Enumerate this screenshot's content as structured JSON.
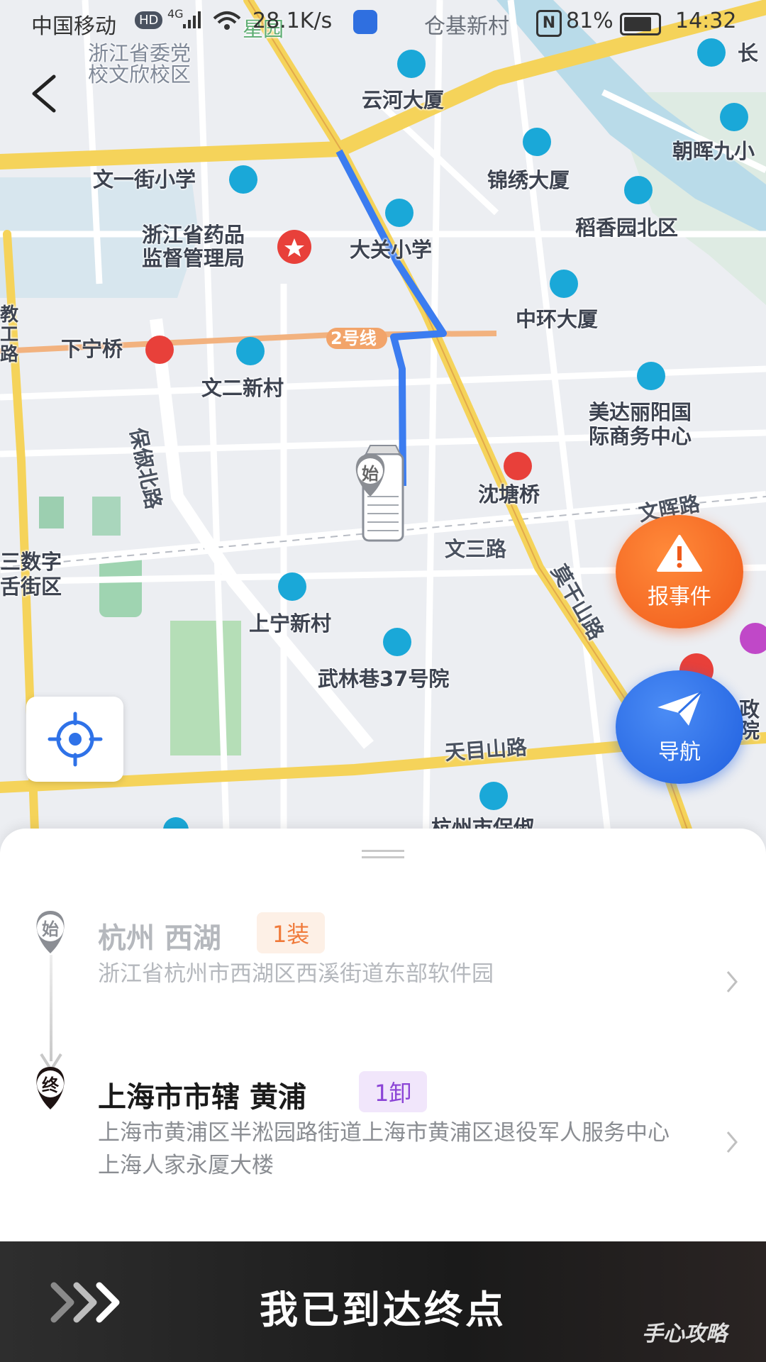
{
  "status_bar": {
    "carrier": "中国移动",
    "hd": "HD",
    "network": "4G",
    "speed": "28.1K/s",
    "location_text": "仓基新村",
    "nfc": "N",
    "battery": "81%",
    "time": "14:32"
  },
  "map": {
    "labels": {
      "zhejiang_party_school": "浙江省委党\n校文欣校区",
      "yunhe_building": "云河大厦",
      "wenyi_street_school": "文一街小学",
      "jinxiu_building": "锦绣大厦",
      "chaohui": "朝晖九小",
      "daoxiang": "稻香园北区",
      "drug_admin": "浙江省药品\n监督管理局",
      "daguan_school": "大关小学",
      "zhonghuan_building": "中环大厦",
      "xianing_bridge": "下宁桥",
      "line2": "2号线",
      "wener_village": "文二新村",
      "meida": "美达丽阳国\n际商务中心",
      "baoshu_road": "保俶北路",
      "shentang_bridge": "沈塘桥",
      "wensan_road": "文三路",
      "moganshan_road": "莫干山路",
      "digital_street": "三数字\n舌街区",
      "shangning_village": "上宁新村",
      "wulinxiang": "武林巷37号院",
      "tianmushan_road": "天目山路",
      "hangzhou_baoshu": "杭州市保俶",
      "changshou": "长",
      "top_green": "星园",
      "right_edge": "政\n院",
      "road_ne": "文晖路",
      "left_edge": "教\n工\n路"
    },
    "start_marker": "始"
  },
  "buttons": {
    "report": "报事件",
    "navigate": "导航"
  },
  "route": {
    "start": {
      "marker": "始",
      "city": "杭州 西湖",
      "tag": "1装",
      "address": "浙江省杭州市西湖区西溪街道东部软件园"
    },
    "end": {
      "marker": "终",
      "city": "上海市市辖 黄浦",
      "tag": "1卸",
      "address": "上海市黄浦区半淞园路街道上海市黄浦区退役军人服务中心上海人家永厦大楼"
    }
  },
  "action": {
    "label": "我已到达终点"
  },
  "watermark": "手心攻略",
  "colors": {
    "route_blue": "#3b7cf0",
    "road_yellow": "#f5d35a",
    "report_orange": "#f26a22",
    "nav_blue": "#2f72e8",
    "load_tag_bg": "#fdf0e6",
    "load_tag_fg": "#f07a3a",
    "unload_tag_bg": "#f1e6fb",
    "unload_tag_fg": "#8b44d6"
  }
}
